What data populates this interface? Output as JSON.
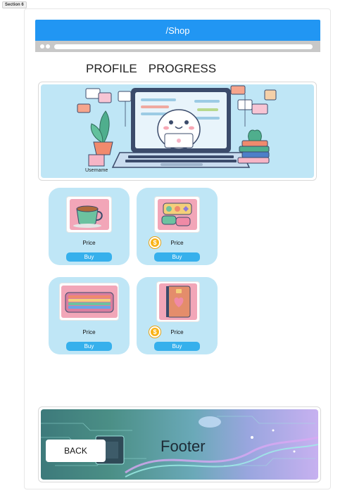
{
  "section_label": "Section 6",
  "header": {
    "title": "/Shop"
  },
  "nav": {
    "profile": "PROFILE",
    "progress": "PROGRESS"
  },
  "hero": {
    "username": "Username"
  },
  "items": [
    {
      "price": "Price",
      "buy": "Buy",
      "icon": "coffee-cup-icon",
      "coin": false
    },
    {
      "price": "Price",
      "buy": "Buy",
      "icon": "gems-icon",
      "coin": true,
      "coin_symbol": "$"
    },
    {
      "price": "Price",
      "buy": "Buy",
      "icon": "rainbow-keyboard-icon",
      "coin": false
    },
    {
      "price": "Price",
      "buy": "Buy",
      "icon": "notebook-icon",
      "coin": true,
      "coin_symbol": "$"
    }
  ],
  "footer": {
    "label": "Footer",
    "back": "BACK"
  },
  "colors": {
    "header": "#2196f3",
    "card": "#bfe6f6",
    "buy_button": "#36b0ec",
    "coin": "#f9b316"
  }
}
